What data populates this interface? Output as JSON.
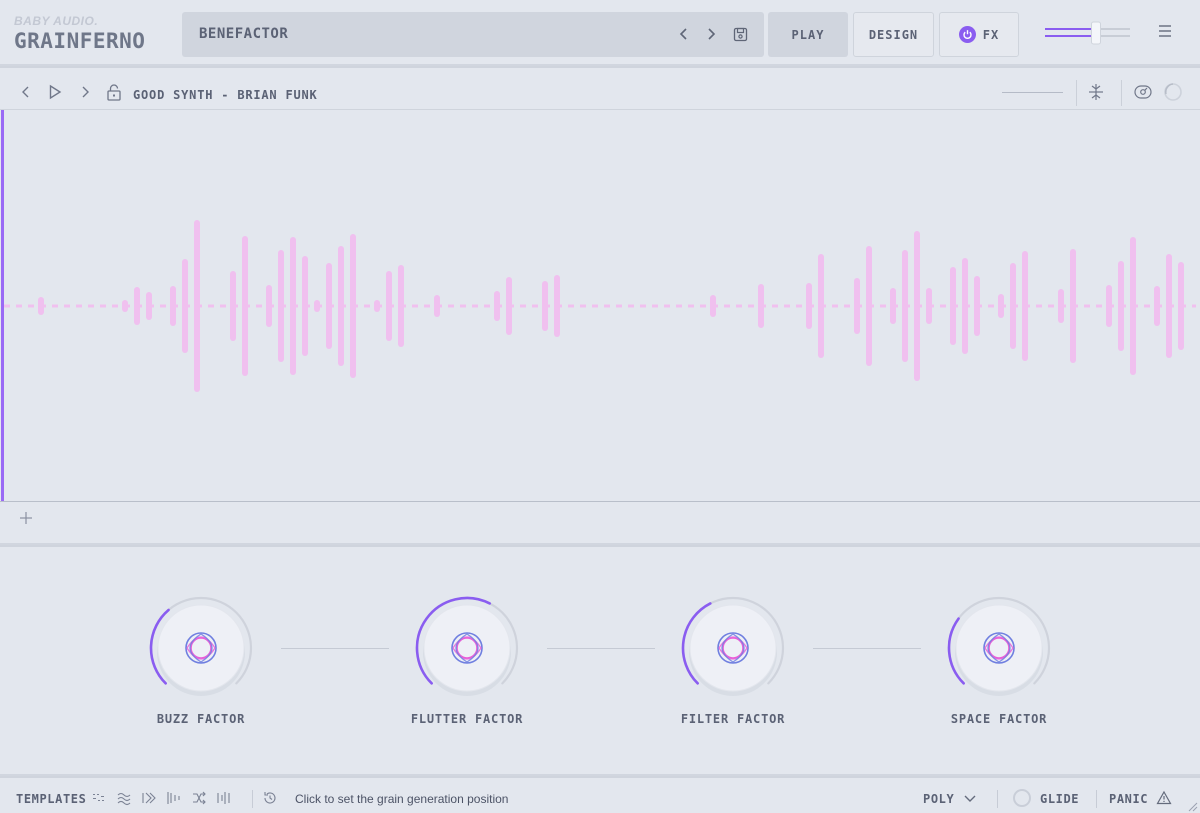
{
  "brand": {
    "maker": "BABY AUDIO.",
    "product": "GRAINFERNO"
  },
  "preset": {
    "name": "BENEFACTOR"
  },
  "tabs": {
    "play": "PLAY",
    "design": "DESIGN",
    "fx": "FX"
  },
  "sample": {
    "name": "GOOD SYNTH - BRIAN FUNK"
  },
  "volume_level": 0.6,
  "waveform": {
    "color": "#f0c0ef",
    "bars": [
      [
        41,
        18
      ],
      [
        125,
        12
      ],
      [
        137,
        38
      ],
      [
        149,
        28
      ],
      [
        173,
        40
      ],
      [
        185,
        94
      ],
      [
        197,
        172
      ],
      [
        233,
        70
      ],
      [
        245,
        140
      ],
      [
        269,
        42
      ],
      [
        281,
        112
      ],
      [
        293,
        138
      ],
      [
        305,
        100
      ],
      [
        317,
        12
      ],
      [
        329,
        86
      ],
      [
        341,
        120
      ],
      [
        353,
        144
      ],
      [
        377,
        12
      ],
      [
        389,
        70
      ],
      [
        401,
        82
      ],
      [
        437,
        22
      ],
      [
        497,
        30
      ],
      [
        509,
        58
      ],
      [
        545,
        50
      ],
      [
        557,
        62
      ],
      [
        713,
        22
      ],
      [
        761,
        44
      ],
      [
        809,
        46
      ],
      [
        821,
        104
      ],
      [
        857,
        56
      ],
      [
        869,
        120
      ],
      [
        893,
        36
      ],
      [
        905,
        112
      ],
      [
        917,
        150
      ],
      [
        929,
        36
      ],
      [
        953,
        78
      ],
      [
        965,
        96
      ],
      [
        977,
        60
      ],
      [
        1001,
        24
      ],
      [
        1013,
        86
      ],
      [
        1025,
        110
      ],
      [
        1061,
        34
      ],
      [
        1073,
        114
      ],
      [
        1109,
        42
      ],
      [
        1121,
        90
      ],
      [
        1133,
        138
      ],
      [
        1157,
        40
      ],
      [
        1169,
        104
      ],
      [
        1181,
        88
      ]
    ]
  },
  "knobs": [
    {
      "label": "BUZZ FACTOR",
      "value": 0.35
    },
    {
      "label": "FLUTTER FACTOR",
      "value": 0.6
    },
    {
      "label": "FILTER FACTOR",
      "value": 0.4
    },
    {
      "label": "SPACE FACTOR",
      "value": 0.3
    }
  ],
  "footer": {
    "templates_label": "TEMPLATES",
    "status": "Click to set the grain generation position",
    "mode": "POLY",
    "glide": "GLIDE",
    "panic": "PANIC"
  },
  "colors": {
    "accent": "#8a5df0",
    "pink": "#e85fd8",
    "blue": "#6f7fe0"
  }
}
